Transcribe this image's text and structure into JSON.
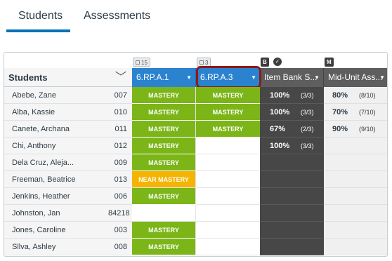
{
  "tabs": [
    {
      "label": "Students",
      "active": true
    },
    {
      "label": "Assessments",
      "active": false
    }
  ],
  "markers": {
    "col1_count": "15",
    "col2_count": "3",
    "col3_badge": "B",
    "col3_check": "✓",
    "col4_badge": "M"
  },
  "header": {
    "students_label": "Students",
    "chevron": "﹀",
    "columns": [
      {
        "label": "6.RP.A.1",
        "style": "blue"
      },
      {
        "label": "6.RP.A.3",
        "style": "blue"
      },
      {
        "label": "Item Bank S...",
        "style": "gray"
      },
      {
        "label": "Mid-Unit Ass...",
        "style": "gray"
      }
    ],
    "caret": "▼"
  },
  "rows": [
    {
      "name": "Abebe, Zane",
      "id": "007",
      "m1": "MASTERY",
      "m2": "MASTERY",
      "s1": {
        "pct": "100%",
        "frac": "(3/3)"
      },
      "s2": {
        "pct": "80%",
        "frac": "(8/10)"
      }
    },
    {
      "name": "Alba, Kassie",
      "id": "010",
      "m1": "MASTERY",
      "m2": "MASTERY",
      "s1": {
        "pct": "100%",
        "frac": "(3/3)"
      },
      "s2": {
        "pct": "70%",
        "frac": "(7/10)"
      }
    },
    {
      "name": "Canete, Archana",
      "id": "011",
      "m1": "MASTERY",
      "m2": "MASTERY",
      "s1": {
        "pct": "67%",
        "frac": "(2/3)"
      },
      "s2": {
        "pct": "90%",
        "frac": "(9/10)"
      }
    },
    {
      "name": "Chi, Anthony",
      "id": "012",
      "m1": "MASTERY",
      "m2": "",
      "s1": {
        "pct": "100%",
        "frac": "(3/3)"
      },
      "s2": {
        "pct": "",
        "frac": ""
      }
    },
    {
      "name": "Dela Cruz, Aleja...",
      "id": "009",
      "m1": "MASTERY",
      "m2": "",
      "s1": {
        "pct": "",
        "frac": ""
      },
      "s2": {
        "pct": "",
        "frac": ""
      }
    },
    {
      "name": "Freeman, Beatrice",
      "id": "013",
      "m1": "NEAR MASTERY",
      "m2": "",
      "s1": {
        "pct": "",
        "frac": ""
      },
      "s2": {
        "pct": "",
        "frac": ""
      }
    },
    {
      "name": "Jenkins, Heather",
      "id": "006",
      "m1": "MASTERY",
      "m2": "",
      "s1": {
        "pct": "",
        "frac": ""
      },
      "s2": {
        "pct": "",
        "frac": ""
      }
    },
    {
      "name": "Johnston, Jan",
      "id": "84218",
      "m1": "",
      "m2": "",
      "s1": {
        "pct": "",
        "frac": ""
      },
      "s2": {
        "pct": "",
        "frac": ""
      }
    },
    {
      "name": "Jones, Caroline",
      "id": "003",
      "m1": "MASTERY",
      "m2": "",
      "s1": {
        "pct": "",
        "frac": ""
      },
      "s2": {
        "pct": "",
        "frac": ""
      }
    },
    {
      "name": "Sllva, Ashley",
      "id": "008",
      "m1": "MASTERY",
      "m2": "",
      "s1": {
        "pct": "",
        "frac": ""
      },
      "s2": {
        "pct": "",
        "frac": ""
      }
    }
  ],
  "colors": {
    "mastery": "#7cb518",
    "near_mastery": "#f5b400",
    "header_blue": "#2b83d0",
    "header_gray": "#5e5e5e",
    "highlight_border": "#8b1a1a",
    "tab_underline": "#0374b5"
  }
}
